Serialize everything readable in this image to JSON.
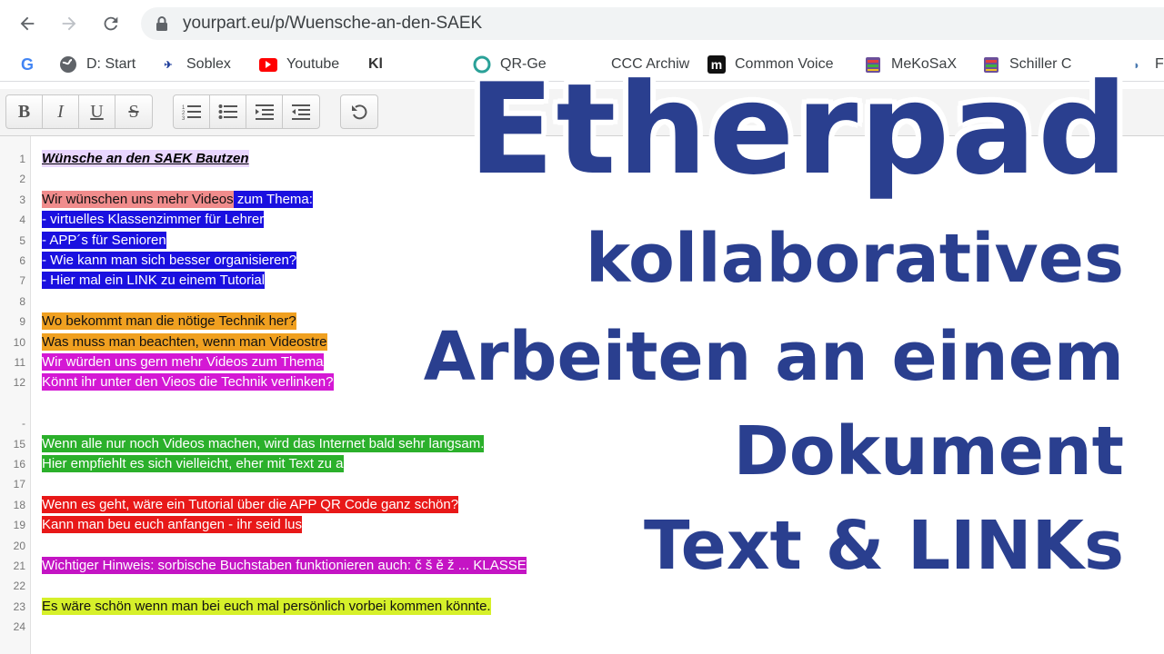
{
  "browser": {
    "url": "yourpart.eu/p/Wuensche-an-den-SAEK",
    "bookmarks": [
      {
        "label": "",
        "icon": "google-icon"
      },
      {
        "label": "D: Start",
        "icon": "globe-icon"
      },
      {
        "label": "Soblex",
        "icon": "soblex-icon"
      },
      {
        "label": "Youtube",
        "icon": "youtube-icon"
      },
      {
        "label": "Kl",
        "icon": "bookmark-icon"
      },
      {
        "label": "QR-Ge",
        "icon": "qr-icon"
      },
      {
        "label": "CCC Archiw",
        "icon": "bookmark-icon"
      },
      {
        "label": "Common Voice",
        "icon": "common-voice-icon"
      },
      {
        "label": "MeKoSaX",
        "icon": "mekosax-icon"
      },
      {
        "label": "Schiller C",
        "icon": "schiller-icon"
      },
      {
        "label": "Fr",
        "icon": "bookmark-icon"
      }
    ]
  },
  "toolbar": {
    "bold": "B",
    "italic": "I",
    "underline": "U",
    "strike": "S"
  },
  "editor": {
    "lines": [
      {
        "n": "1",
        "segs": [
          {
            "t": "Wünsche an den SAEK Bautzen",
            "c": "c-title"
          }
        ]
      },
      {
        "n": "2",
        "segs": []
      },
      {
        "n": "3",
        "segs": [
          {
            "t": "Wir wünschen uns mehr Videos",
            "c": "c-pink"
          },
          {
            "t": " zum Thema:",
            "c": "c-blue"
          }
        ]
      },
      {
        "n": "4",
        "segs": [
          {
            "t": "- virtuelles Klassenzimmer für Lehrer",
            "c": "c-blue"
          }
        ]
      },
      {
        "n": "5",
        "segs": [
          {
            "t": "- APP´s für Senioren",
            "c": "c-blue"
          }
        ]
      },
      {
        "n": "6",
        "segs": [
          {
            "t": "- Wie kann man sich besser organisieren?",
            "c": "c-blue"
          }
        ]
      },
      {
        "n": "7",
        "segs": [
          {
            "t": "- Hier mal ein LINK zu einem Tutorial",
            "c": "c-blue"
          }
        ]
      },
      {
        "n": "8",
        "segs": []
      },
      {
        "n": "9",
        "segs": [
          {
            "t": "Wo bekommt man die nötige Technik her?",
            "c": "c-orange"
          }
        ]
      },
      {
        "n": "10",
        "segs": [
          {
            "t": "Was muss man beachten, wenn man Videostre",
            "c": "c-orange"
          }
        ]
      },
      {
        "n": "11",
        "segs": [
          {
            "t": "Wir würden uns gern mehr Videos zum Thema",
            "c": "c-magenta"
          }
        ]
      },
      {
        "n": "12",
        "segs": [
          {
            "t": "Könnt ihr unter den Vieos die Technik verlinken?",
            "c": "c-magenta"
          }
        ]
      },
      {
        "n": "",
        "segs": []
      },
      {
        "n": "-",
        "segs": []
      },
      {
        "n": "15",
        "segs": [
          {
            "t": "Wenn alle nur noch Videos machen, wird das Internet bald sehr langsam.",
            "c": "c-green"
          }
        ]
      },
      {
        "n": "16",
        "segs": [
          {
            "t": "Hier empfiehlt es sich vielleicht, eher mit Text zu a",
            "c": "c-green"
          }
        ]
      },
      {
        "n": "17",
        "segs": []
      },
      {
        "n": "18",
        "segs": [
          {
            "t": "Wenn es geht, wäre ein Tutorial über die APP QR Code ganz schön?",
            "c": "c-red"
          }
        ]
      },
      {
        "n": "19",
        "segs": [
          {
            "t": "Kann man beu euch anfangen - ihr seid lus",
            "c": "c-red"
          }
        ]
      },
      {
        "n": "20",
        "segs": []
      },
      {
        "n": "21",
        "segs": [
          {
            "t": "Wichtiger Hinweis: sorbische Buchstaben funktionieren auch: č š ě ž ... KLASSE",
            "c": "c-violet"
          }
        ]
      },
      {
        "n": "22",
        "segs": []
      },
      {
        "n": "23",
        "segs": [
          {
            "t": "Es wäre schön wenn man bei euch mal persönlich vorbei kommen könnte.",
            "c": "c-yellow"
          }
        ]
      },
      {
        "n": "24",
        "segs": []
      }
    ]
  },
  "overlay": {
    "line1": "Etherpad",
    "line2": "kollaboratives",
    "line3": "Arbeiten an einem",
    "line4": "Dokument",
    "line5": "Text & LINKs",
    "color": "#2a3f8f"
  }
}
